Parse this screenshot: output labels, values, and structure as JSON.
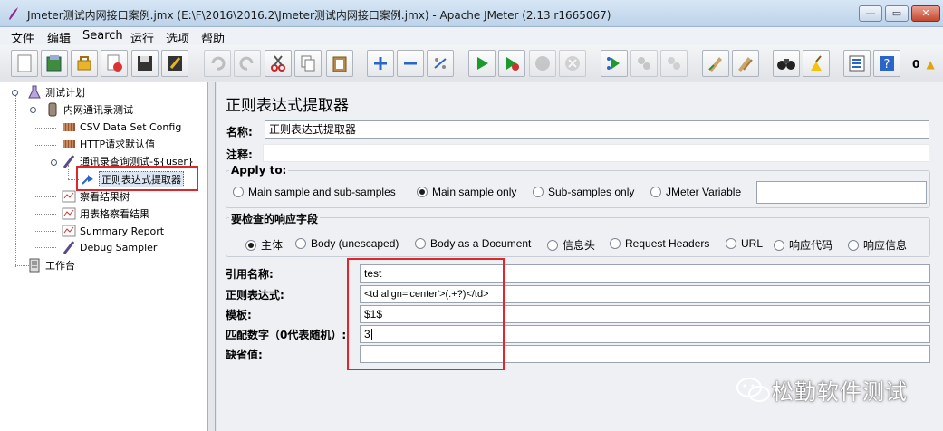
{
  "window": {
    "title": "Jmeter测试内网接口案例.jmx (E:\\F\\2016\\2016.2\\Jmeter测试内网接口案例.jmx) - Apache JMeter (2.13 r1665067)",
    "minimize_glyph": "—",
    "maximize_glyph": "▭",
    "close_glyph": "✕"
  },
  "menu": [
    "文件",
    "编辑",
    "Search",
    "运行",
    "选项",
    "帮助"
  ],
  "toolbar": {
    "buttons": [
      {
        "icon": "new-icon"
      },
      {
        "icon": "templates-icon"
      },
      {
        "icon": "open-icon"
      },
      {
        "icon": "close-plan-icon"
      },
      {
        "icon": "save-icon"
      },
      {
        "icon": "save-as-icon"
      },
      {
        "icon": "undo-icon"
      },
      {
        "icon": "redo-icon"
      },
      {
        "icon": "cut-icon"
      },
      {
        "icon": "copy-icon"
      },
      {
        "icon": "paste-icon"
      },
      {
        "icon": "expand-icon"
      },
      {
        "icon": "collapse-icon"
      },
      {
        "icon": "toggle-icon"
      },
      {
        "icon": "start-icon"
      },
      {
        "icon": "start-no-pause-icon"
      },
      {
        "icon": "stop-icon"
      },
      {
        "icon": "shutdown-icon"
      },
      {
        "icon": "remote-start-icon"
      },
      {
        "icon": "remote-stop-icon"
      },
      {
        "icon": "remote-shutdown-icon"
      },
      {
        "icon": "clear-icon"
      },
      {
        "icon": "clear-all-icon"
      },
      {
        "icon": "search-icon"
      },
      {
        "icon": "reset-search-icon"
      },
      {
        "icon": "function-helper-icon"
      },
      {
        "icon": "help-icon"
      }
    ],
    "status_count": "0",
    "warning_glyph": "▲"
  },
  "tree": {
    "nodes": [
      {
        "label": "测试计划",
        "icon": "test-plan-icon"
      },
      {
        "label": "内网通讯录测试",
        "icon": "thread-group-icon"
      },
      {
        "label": "CSV Data Set Config",
        "icon": "config-element-icon"
      },
      {
        "label": "HTTP请求默认值",
        "icon": "config-element-icon"
      },
      {
        "label": "通讯录查询测试-${user}",
        "icon": "sampler-icon"
      },
      {
        "label": "正则表达式提取器",
        "icon": "post-processor-icon"
      },
      {
        "label": "察看结果树",
        "icon": "listener-icon"
      },
      {
        "label": "用表格察看结果",
        "icon": "listener-icon"
      },
      {
        "label": "Summary Report",
        "icon": "listener-icon"
      },
      {
        "label": "Debug Sampler",
        "icon": "sampler-icon"
      },
      {
        "label": "工作台",
        "icon": "workbench-icon"
      }
    ]
  },
  "panel": {
    "title": "正则表达式提取器",
    "name_label": "名称:",
    "name_value": "正则表达式提取器",
    "comment_label": "注释:",
    "comment_value": "",
    "apply_to": {
      "title": "Apply to:",
      "options": [
        "Main sample and sub-samples",
        "Main sample only",
        "Sub-samples only",
        "JMeter Variable"
      ],
      "selected_index": 1,
      "variable_value": ""
    },
    "response_field": {
      "title": "要检查的响应字段",
      "options": [
        "主体",
        "Body (unescaped)",
        "Body as a Document",
        "信息头",
        "Request Headers",
        "URL",
        "响应代码",
        "响应信息"
      ],
      "selected_index": 0
    },
    "fields": [
      {
        "label": "引用名称:",
        "value": "test"
      },
      {
        "label": "正则表达式:",
        "value": "<td align='center'>(.+?)</td>"
      },
      {
        "label": "模板:",
        "value": "$1$"
      },
      {
        "label": "匹配数字（0代表随机）:",
        "value": "3"
      },
      {
        "label": "缺省值:",
        "value": ""
      }
    ]
  },
  "watermark": {
    "text": "松勤软件测试",
    "icon": "wechat-icon"
  },
  "colors": {
    "highlight_frame": "#e0262b",
    "title_bar": "#c9dcef"
  }
}
